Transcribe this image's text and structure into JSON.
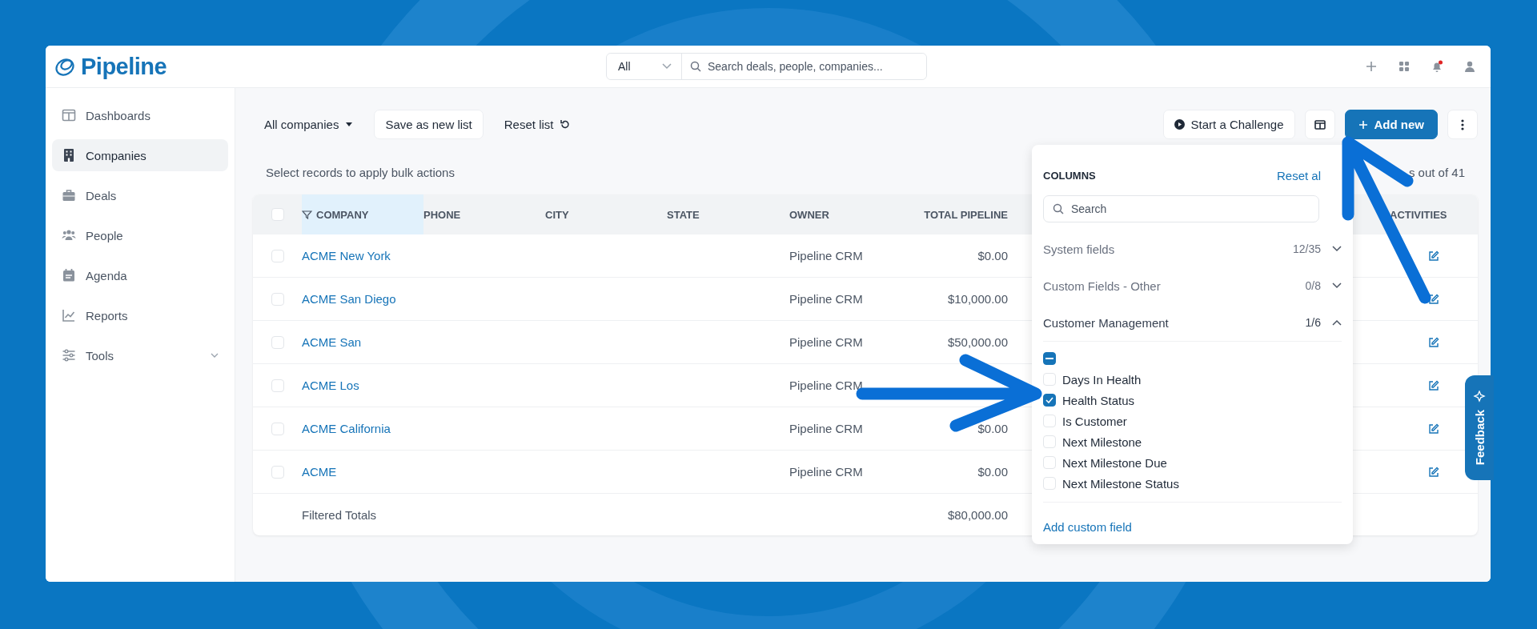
{
  "header": {
    "logo": "Pipeline",
    "scope": "All",
    "search": {
      "placeholder": "Search deals, people, companies..."
    },
    "notifications_unread": true
  },
  "sidebar": {
    "items": [
      {
        "label": "Dashboards",
        "selected": false,
        "expandable": false
      },
      {
        "label": "Companies",
        "selected": true,
        "expandable": false
      },
      {
        "label": "Deals",
        "selected": false,
        "expandable": false
      },
      {
        "label": "People",
        "selected": false,
        "expandable": false
      },
      {
        "label": "Agenda",
        "selected": false,
        "expandable": false
      },
      {
        "label": "Reports",
        "selected": false,
        "expandable": false
      },
      {
        "label": "Tools",
        "selected": false,
        "expandable": true
      }
    ]
  },
  "toolbar": {
    "list_selector": "All companies",
    "save_button": "Save as new list",
    "reset_button": "Reset list",
    "challenge_button": "Start a Challenge",
    "add_button": "Add new"
  },
  "bulk_hint": "Select records to apply bulk actions",
  "record_count": "s out of 41",
  "table": {
    "select_all_checked": false,
    "columns": [
      {
        "label": "COMPANY",
        "highlighted": true
      },
      {
        "label": "PHONE",
        "highlighted": false
      },
      {
        "label": "CITY",
        "highlighted": false
      },
      {
        "label": "STATE",
        "highlighted": false
      },
      {
        "label": "OWNER",
        "highlighted": false
      },
      {
        "label": "TOTAL PIPELINE",
        "highlighted": false
      },
      {
        "label": "ACTIVITIES",
        "highlighted": false
      }
    ],
    "rows": [
      {
        "checked": false,
        "company": "ACME New York",
        "owner": "Pipeline CRM",
        "total_pipeline": "$0.00"
      },
      {
        "checked": false,
        "company": "ACME San Diego",
        "owner": "Pipeline CRM",
        "total_pipeline": "$10,000.00"
      },
      {
        "checked": false,
        "company": "ACME San",
        "owner": "Pipeline CRM",
        "total_pipeline": "$50,000.00"
      },
      {
        "checked": false,
        "company": "ACME Los",
        "owner": "Pipeline CRM"
      },
      {
        "checked": false,
        "company": "ACME California",
        "owner": "Pipeline CRM",
        "total_pipeline": "$0.00"
      },
      {
        "checked": false,
        "company": "ACME",
        "owner": "Pipeline CRM",
        "total_pipeline": "$0.00"
      }
    ],
    "totals": {
      "label": "Filtered Totals",
      "total_pipeline": "$80,000.00"
    }
  },
  "columns_menu": {
    "title": "COLUMNS",
    "reset": "Reset al",
    "search": {
      "placeholder": "Search"
    },
    "groups": [
      {
        "label": "System fields",
        "count": "12/35",
        "expanded": false
      },
      {
        "label": "Custom Fields - Other",
        "count": "0/8",
        "expanded": false
      },
      {
        "label": "Customer Management",
        "count": "1/6",
        "expanded": true,
        "select_all_indeterminate": true,
        "fields": [
          {
            "label": "Days In Health",
            "checked": false
          },
          {
            "label": "Health Status",
            "checked": true
          },
          {
            "label": "Is Customer",
            "checked": false
          },
          {
            "label": "Next Milestone",
            "checked": false
          },
          {
            "label": "Next Milestone Due",
            "checked": false
          },
          {
            "label": "Next Milestone Status",
            "checked": false
          }
        ]
      }
    ],
    "add_link": "Add custom field"
  },
  "feedback_tab": "Feedback"
}
